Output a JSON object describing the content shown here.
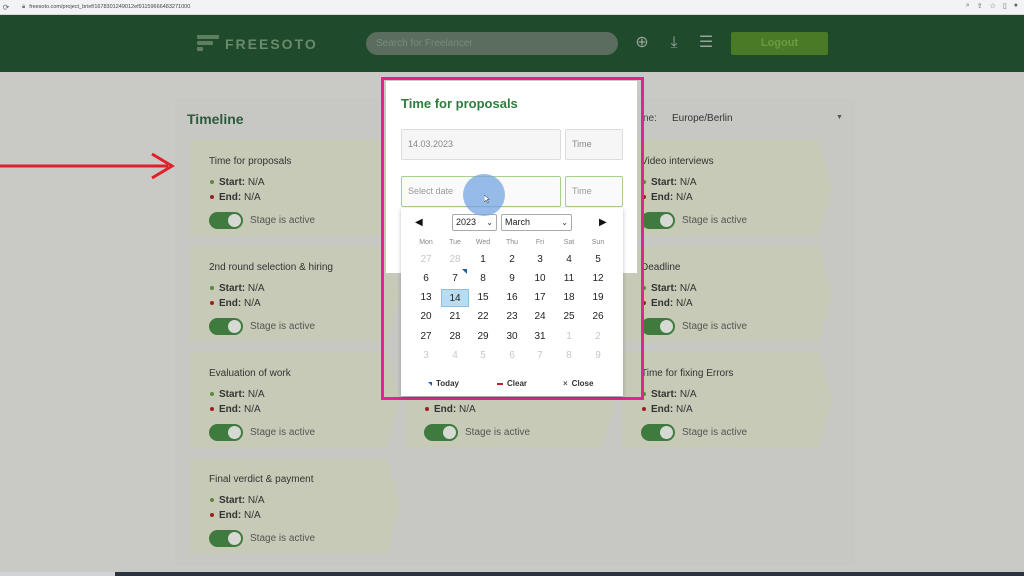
{
  "browser": {
    "url": "freesoto.com/project_brief/1678301249012ef91159666483271000"
  },
  "header": {
    "logo_text": "FREESOTO",
    "search_placeholder": "Search for Freelancer",
    "logout_label": "Logout"
  },
  "timeline": {
    "title": "Timeline",
    "timezone_label": "ne:",
    "timezone_value": "Europe/Berlin",
    "stages": [
      {
        "title": "Time for proposals",
        "start_label": "Start:",
        "start": "N/A",
        "end_label": "End:",
        "end": "N/A",
        "active_label": "Stage is active"
      },
      {
        "title": "Video interviews",
        "start_label": "Start:",
        "start": "N/A",
        "end_label": "End:",
        "end": "N/A",
        "active_label": "Stage is active"
      },
      {
        "title": "2nd round selection & hiring",
        "start_label": "Start:",
        "start": "N/A",
        "end_label": "End:",
        "end": "N/A",
        "active_label": "Stage is active"
      },
      {
        "title": "Deadline",
        "start_label": "Start:",
        "start": "N/A",
        "end_label": "End:",
        "end": "N/A",
        "active_label": "Stage is active"
      },
      {
        "title": "Evaluation of work",
        "start_label": "Start:",
        "start": "N/A",
        "end_label": "End:",
        "end": "N/A",
        "active_label": "Stage is active"
      },
      {
        "title": "",
        "start_label": "",
        "start": "",
        "end_label": "End:",
        "end": "N/A",
        "active_label": "Stage is active"
      },
      {
        "title": "Time for fixing Errors",
        "start_label": "Start:",
        "start": "N/A",
        "end_label": "End:",
        "end": "N/A",
        "active_label": "Stage is active"
      },
      {
        "title": "Final verdict & payment",
        "start_label": "Start:",
        "start": "N/A",
        "end_label": "End:",
        "end": "N/A",
        "active_label": "Stage is active"
      }
    ]
  },
  "modal": {
    "title": "Time for proposals",
    "start_date": "14.03.2023",
    "start_time_placeholder": "Time",
    "end_date_placeholder": "Select date",
    "end_time_placeholder": "Time"
  },
  "calendar": {
    "year": "2023",
    "month": "March",
    "weekdays": [
      "Mon",
      "Tue",
      "Wed",
      "Thu",
      "Fri",
      "Sat",
      "Sun"
    ],
    "weeks": [
      [
        "27",
        "28",
        "1",
        "2",
        "3",
        "4",
        "5"
      ],
      [
        "6",
        "7",
        "8",
        "9",
        "10",
        "11",
        "12"
      ],
      [
        "13",
        "14",
        "15",
        "16",
        "17",
        "18",
        "19"
      ],
      [
        "20",
        "21",
        "22",
        "23",
        "24",
        "25",
        "26"
      ],
      [
        "27",
        "28",
        "29",
        "30",
        "31",
        "1",
        "2"
      ],
      [
        "3",
        "4",
        "5",
        "6",
        "7",
        "8",
        "9"
      ]
    ],
    "selected_day": "14",
    "today_day": "7",
    "today_label": "Today",
    "clear_label": "Clear",
    "close_label": "Close",
    "close_glyph": "×"
  },
  "colors": {
    "header_bg": "#1f4a2b",
    "accent_green": "#2e7d3e",
    "highlight_pink": "#e0268a",
    "arrow_red": "#e0202a",
    "selected_day": "#b9dcf2"
  }
}
